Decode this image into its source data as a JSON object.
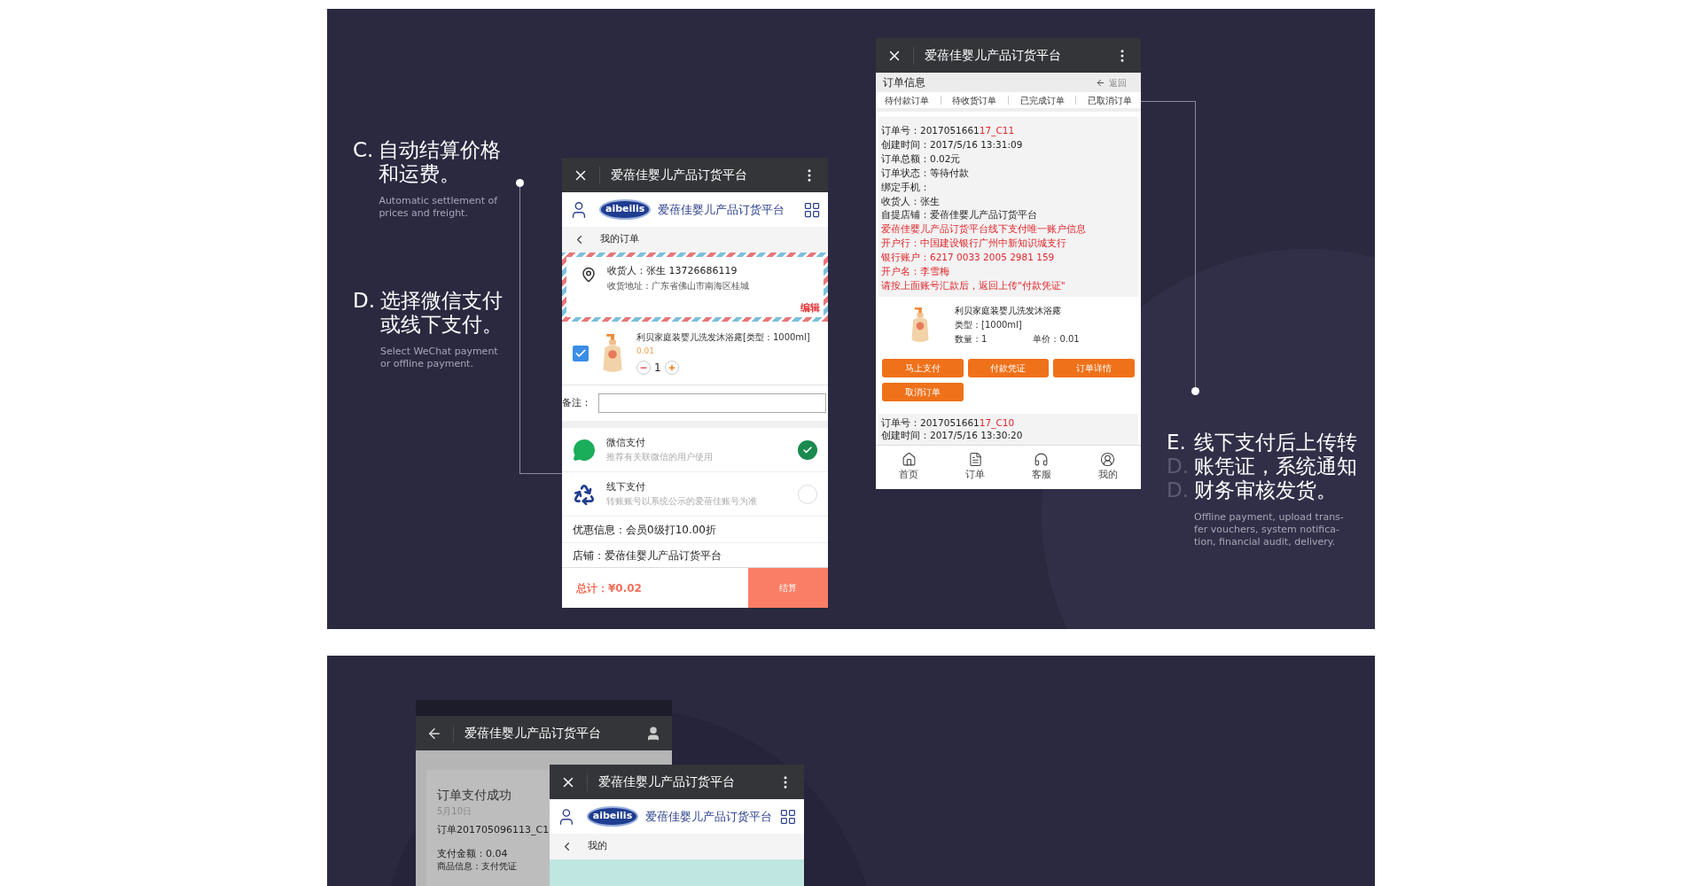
{
  "features": [
    {
      "letter": "C.",
      "title_lines": [
        "自动结算价格",
        "和运费。"
      ],
      "subtitle_lines": [
        "Automatic settlement of",
        "prices and freight."
      ]
    },
    {
      "letter": "D.",
      "title_lines": [
        "选择微信支付",
        "或线下支付。"
      ],
      "subtitle_lines": [
        "Select WeChat payment",
        "or offline payment."
      ]
    },
    {
      "letter": "E.",
      "ghost_letters": [
        "D.",
        "D."
      ],
      "title_lines": [
        "线下支付后上传转",
        "账凭证，系统通知",
        "财务审核发货。"
      ],
      "subtitle_lines": [
        "Offline payment, upload trans-",
        "fer vouchers, system notifica-",
        "tion, financial audit, delivery."
      ]
    }
  ],
  "checkout_phone": {
    "title": "爱蓓佳婴儿产品订货平台",
    "logo": "aibeilis",
    "brand": "爱蓓佳婴儿产品订货平台",
    "breadcrumb": "我的订单",
    "address": {
      "receiver": "收货人：张生 13726686119",
      "address": "收货地址：广东省佛山市南海区桂城",
      "edit": "编辑"
    },
    "product": {
      "checked": true,
      "name": "利贝家庭装婴儿洗发沐浴露[类型：1000ml]",
      "price": "0.01",
      "quantity": "1"
    },
    "remark_label": "备注：",
    "payments": [
      {
        "kind": "wechat",
        "name": "微信支付",
        "hint": "推荐有关联微信的用户使用",
        "selected": true
      },
      {
        "kind": "offline",
        "name": "线下支付",
        "hint": "转账账号以系统公示的爱蓓佳账号为准",
        "selected": false
      }
    ],
    "discount": "优惠信息：会员0级打10.00折",
    "store": "店铺：爱蓓佳婴儿产品订货平台",
    "total": "总计：¥0.02",
    "checkout": "结算"
  },
  "orders_phone": {
    "title": "爱蓓佳婴儿产品订货平台",
    "section": "订单信息",
    "back": "返回",
    "tabs": [
      "待付款订单",
      "待收货订单",
      "已完成订单",
      "已取消订单"
    ],
    "lines": [
      {
        "kind": "plain",
        "text": "订单号：2017051661",
        "accent": "17_C11"
      },
      {
        "kind": "plain",
        "text": "创建时间：2017/5/16 13:31:09"
      },
      {
        "kind": "plain",
        "text": "订单总额：0.02元"
      },
      {
        "kind": "plain",
        "text": "订单状态：等待付款"
      },
      {
        "kind": "plain",
        "text": "绑定手机："
      },
      {
        "kind": "plain",
        "text": "收货人：张生"
      },
      {
        "kind": "plain",
        "text": "自提店铺：爱蓓佳婴儿产品订货平台"
      },
      {
        "kind": "alert",
        "text": "爱蓓佳婴儿产品订货平台线下支付唯一账户信息"
      },
      {
        "kind": "alert",
        "text": "开户行：中国建设银行广州中新知识城支行"
      },
      {
        "kind": "alert",
        "text": "银行账户：6217 0033 2005 2981 159"
      },
      {
        "kind": "alert",
        "text": "开户名：李雪梅"
      },
      {
        "kind": "alert",
        "text": "请按上面账号汇款后，返回上传\"付款凭证\""
      }
    ],
    "product": {
      "name": "利贝家庭装婴儿洗发沐浴露",
      "type": "类型：[1000ml]",
      "quantity": "数量：1",
      "price": "单价：0.01"
    },
    "actions": [
      "马上支付",
      "付款凭证",
      "订单详情",
      "取消订单"
    ],
    "next_order": {
      "number": "订单号：2017051661",
      "accent": "17_C10",
      "created": "创建时间：2017/5/16 13:30:20"
    },
    "nav": [
      {
        "kind": "home",
        "label": "首页"
      },
      {
        "kind": "orders",
        "label": "订单"
      },
      {
        "kind": "service",
        "label": "客服"
      },
      {
        "kind": "profile",
        "label": "我的"
      }
    ]
  },
  "success_phone": {
    "title": "爱蓓佳婴儿产品订货平台",
    "heading": "订单支付成功",
    "date": "5月10日",
    "order": "订单201705096113_C1",
    "amount": "支付金额：0.04",
    "goods": "商品信息：支付凭证"
  },
  "profile_phone": {
    "title": "爱蓓佳婴儿产品订货平台",
    "logo": "aibeilis",
    "brand": "爱蓓佳婴儿产品订货平台",
    "breadcrumb": "我的"
  }
}
